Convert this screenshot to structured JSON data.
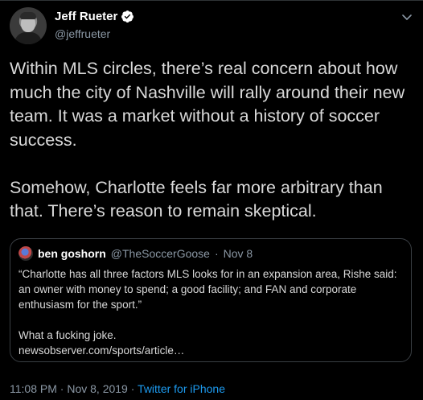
{
  "author": {
    "display_name": "Jeff Rueter",
    "handle": "@jeffrueter",
    "verified": true
  },
  "tweet": {
    "text": "Within MLS circles, there’s real concern about how much the city of Nashville will rally around their new team. It was a market without a history of soccer success.\n\nSomehow, Charlotte feels far more arbitrary than that. There’s reason to remain skeptical."
  },
  "quoted": {
    "display_name": "ben goshorn",
    "handle": "@TheSoccerGoose",
    "separator": "·",
    "date": "Nov 8",
    "text": "“Charlotte has all three factors MLS looks for in an expansion area, Rishe said: an owner with money to spend; a good facility; and FAN and corporate enthusiasm for the sport.”\n\nWhat a fucking joke.\nnewsobserver.com/sports/article…"
  },
  "footer": {
    "time": "11:08 PM",
    "separator": "·",
    "date": "Nov 8, 2019",
    "source": "Twitter for iPhone"
  },
  "colors": {
    "background": "#000000",
    "accent": "#1d9bf0",
    "muted": "#8b98a5"
  },
  "icons": {
    "verified": "verified-badge-icon",
    "menu": "chevron-down-icon"
  }
}
